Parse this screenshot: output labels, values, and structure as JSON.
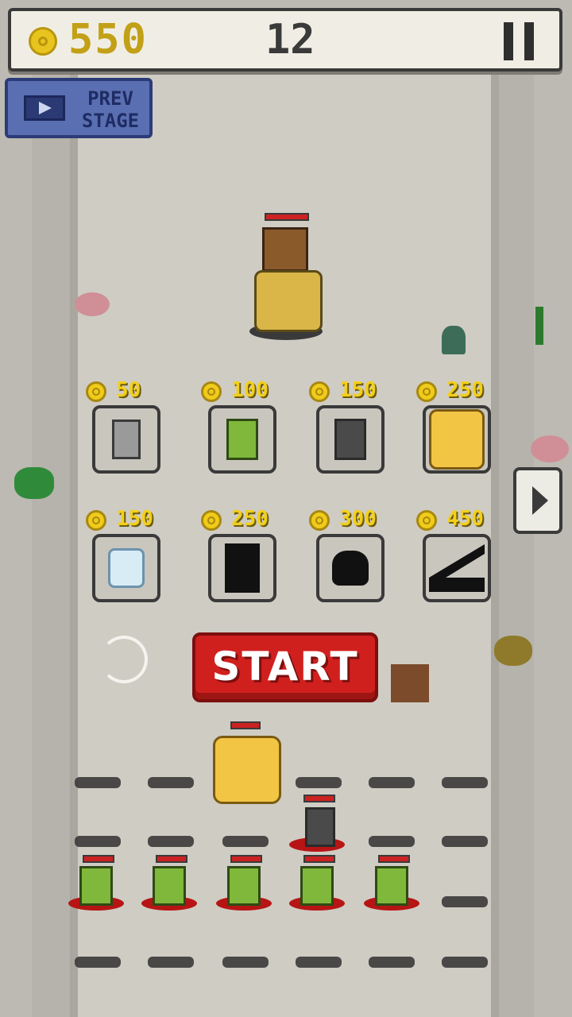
{
  "hud": {
    "gold": "550",
    "wave": "12",
    "pause_icon": "pause-icon"
  },
  "prev_stage": {
    "line1": "PREV",
    "line2": "STAGE",
    "icon": "film-icon"
  },
  "shop": {
    "units": [
      {
        "name": "knight",
        "price": "50"
      },
      {
        "name": "goblin-archer",
        "price": "100"
      },
      {
        "name": "dark-mage",
        "price": "150"
      },
      {
        "name": "ogre",
        "price": "250"
      },
      {
        "name": "angel",
        "price": "150"
      },
      {
        "name": "locked-cavalry",
        "price": "250"
      },
      {
        "name": "locked-beast",
        "price": "300"
      },
      {
        "name": "locked-catapult",
        "price": "450"
      }
    ],
    "next_icon": "chevron-right-icon"
  },
  "controls": {
    "start_label": "START",
    "restart_icon": "restart-icon"
  },
  "colors": {
    "gold": "#f2cf1c",
    "start_red": "#d0201e",
    "prev_blue": "#5a6fb2",
    "road": "#cfccc4"
  }
}
